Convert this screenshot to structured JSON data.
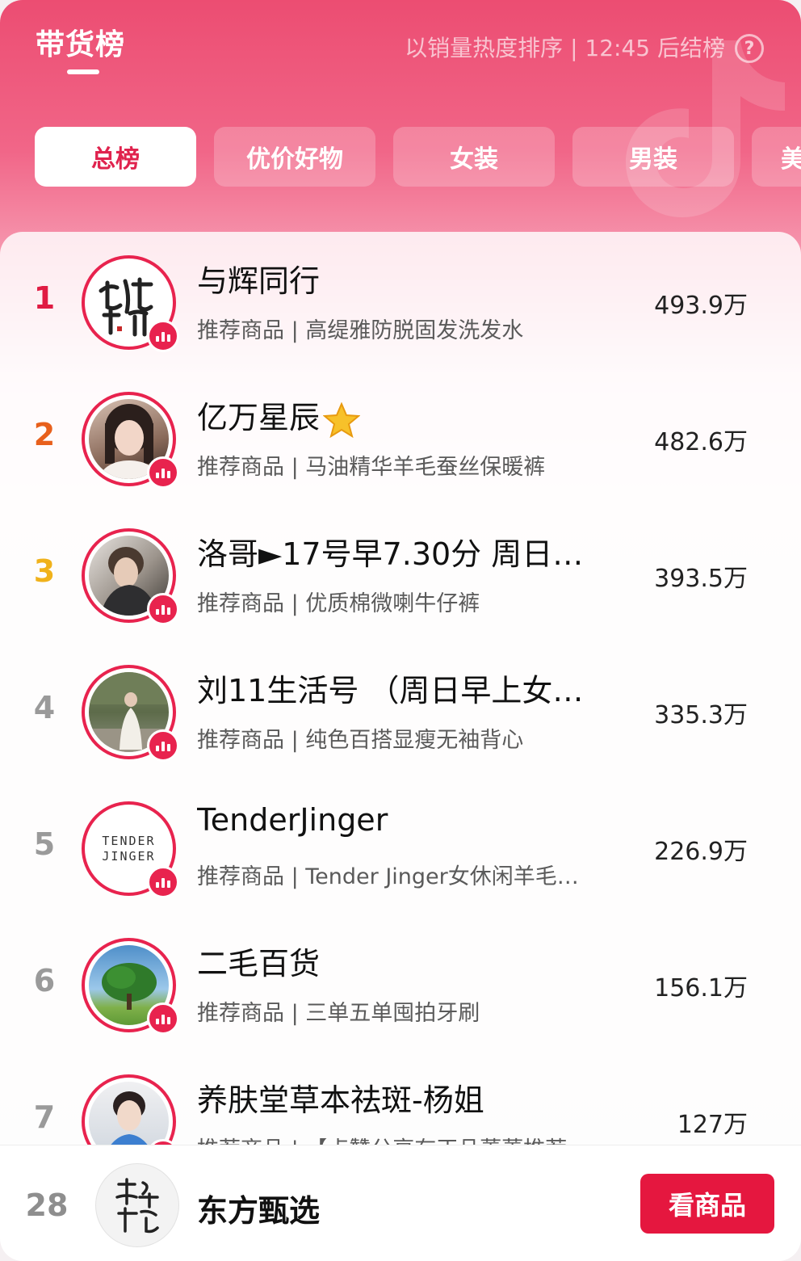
{
  "header": {
    "title": "带货榜",
    "rule_text": "以销量热度排序 | 12:45 后结榜",
    "help_icon": "question-circle-icon"
  },
  "tabs": [
    {
      "label": "总榜",
      "active": true
    },
    {
      "label": "优价好物",
      "active": false
    },
    {
      "label": "女装",
      "active": false
    },
    {
      "label": "男装",
      "active": false
    },
    {
      "label": "美",
      "active": false
    }
  ],
  "list": [
    {
      "rank": "1",
      "name": "与辉同行",
      "sub": "推荐商品 | 高缇雅防脱固发洗发水",
      "sales": "493.9万",
      "avatar": "calligraphy-logo-avatar"
    },
    {
      "rank": "2",
      "name": "亿万星辰",
      "sub": "推荐商品 | 马油精华羊毛蚕丝保暖裤",
      "sales": "482.6万",
      "avatar": "portrait-avatar",
      "badge_icon": "star-icon"
    },
    {
      "rank": "3",
      "name": "洛哥►17号早7.30分 周日…",
      "sub": "推荐商品 | 优质棉微喇牛仔裤",
      "sales": "393.5万",
      "avatar": "portrait-avatar"
    },
    {
      "rank": "4",
      "name": "刘11生活号 （周日早上女…",
      "sub": "推荐商品 | 纯色百搭显瘦无袖背心",
      "sales": "335.3万",
      "avatar": "outdoor-photo-avatar"
    },
    {
      "rank": "5",
      "name": "TenderJinger",
      "sub": "推荐商品 | Tender Jinger女休闲羊毛…",
      "sales": "226.9万",
      "avatar": "text-logo-avatar",
      "avatar_text": "TENDER JINGER"
    },
    {
      "rank": "6",
      "name": "二毛百货",
      "sub": "推荐商品 | 三单五单囤拍牙刷",
      "sales": "156.1万",
      "avatar": "tree-avatar"
    },
    {
      "rank": "7",
      "name": "养肤堂草本祛斑-杨姐",
      "sub": "推荐商品 | 【点赞分享有正品蕾蕾推荐",
      "sales": "127万",
      "avatar": "portrait-avatar"
    }
  ],
  "footer": {
    "rank": "28",
    "name": "东方甄选",
    "button": "看商品",
    "avatar": "calligraphy-logo-avatar"
  },
  "colors": {
    "accent": "#e8234e",
    "rank1": "#e01c43",
    "rank2": "#e8601c",
    "rank3": "#f0b21b"
  }
}
